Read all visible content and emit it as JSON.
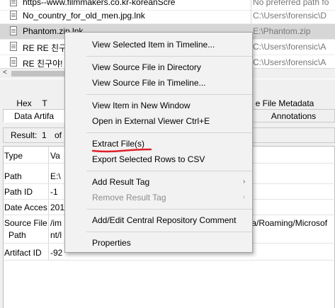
{
  "file_list": {
    "rows": [
      {
        "name": "https--www.filmmakers.co.kr-koreanScre",
        "path": "No preferred path fo"
      },
      {
        "name": "No_country_for_old_men.jpg.lnk",
        "path": "C:\\Users\\forensic\\D"
      },
      {
        "name": "Phantom.zip.lnk",
        "path": "E:\\Phantom.zip",
        "selected": true
      },
      {
        "name": "RE RE 친구",
        "path": "C:\\Users\\forensic\\A"
      },
      {
        "name": "RE 친구야!",
        "path": "C:\\Users\\forensic\\A"
      }
    ],
    "scroll_left_glyph": "<"
  },
  "tabs_row1": {
    "hex": "Hex",
    "t": "T",
    "file_metadata": "e File Metadata"
  },
  "tabs_row2": {
    "data_artifacts": "Data Artifa",
    "annotations": "Annotations"
  },
  "result_bar": {
    "label": "Result:",
    "current": "1",
    "of": "of"
  },
  "properties": {
    "header_type": "Type",
    "header_value": "Va",
    "rows": [
      {
        "key": "Path",
        "value": "E:\\"
      },
      {
        "key": "Path ID",
        "value": "-1"
      },
      {
        "key": "Date Acces",
        "value": "201"
      },
      {
        "key": "Source File",
        "key2": "Path",
        "value": "/im",
        "value2": "nt/l",
        "value_tail": "ta/Roaming/Microsof"
      },
      {
        "key": "Artifact ID",
        "value": "-92"
      }
    ]
  },
  "context_menu": {
    "view_timeline": "View Selected Item in Timeline...",
    "view_source_dir": "View Source File in Directory",
    "view_source_timeline": "View Source File in Timeline...",
    "view_new_window": "View Item in New Window",
    "open_external": "Open in External Viewer  Ctrl+E",
    "extract": "Extract File(s)",
    "export_csv": "Export Selected Rows to CSV",
    "add_tag": "Add Result Tag",
    "remove_tag": "Remove Result Tag",
    "add_comment": "Add/Edit Central Repository Comment",
    "properties": "Properties",
    "submenu_glyph": "›"
  },
  "colors": {
    "selection": "#d6d6d6",
    "menu_bg": "#f2f2f2",
    "annotation_red": "#e0202a"
  }
}
